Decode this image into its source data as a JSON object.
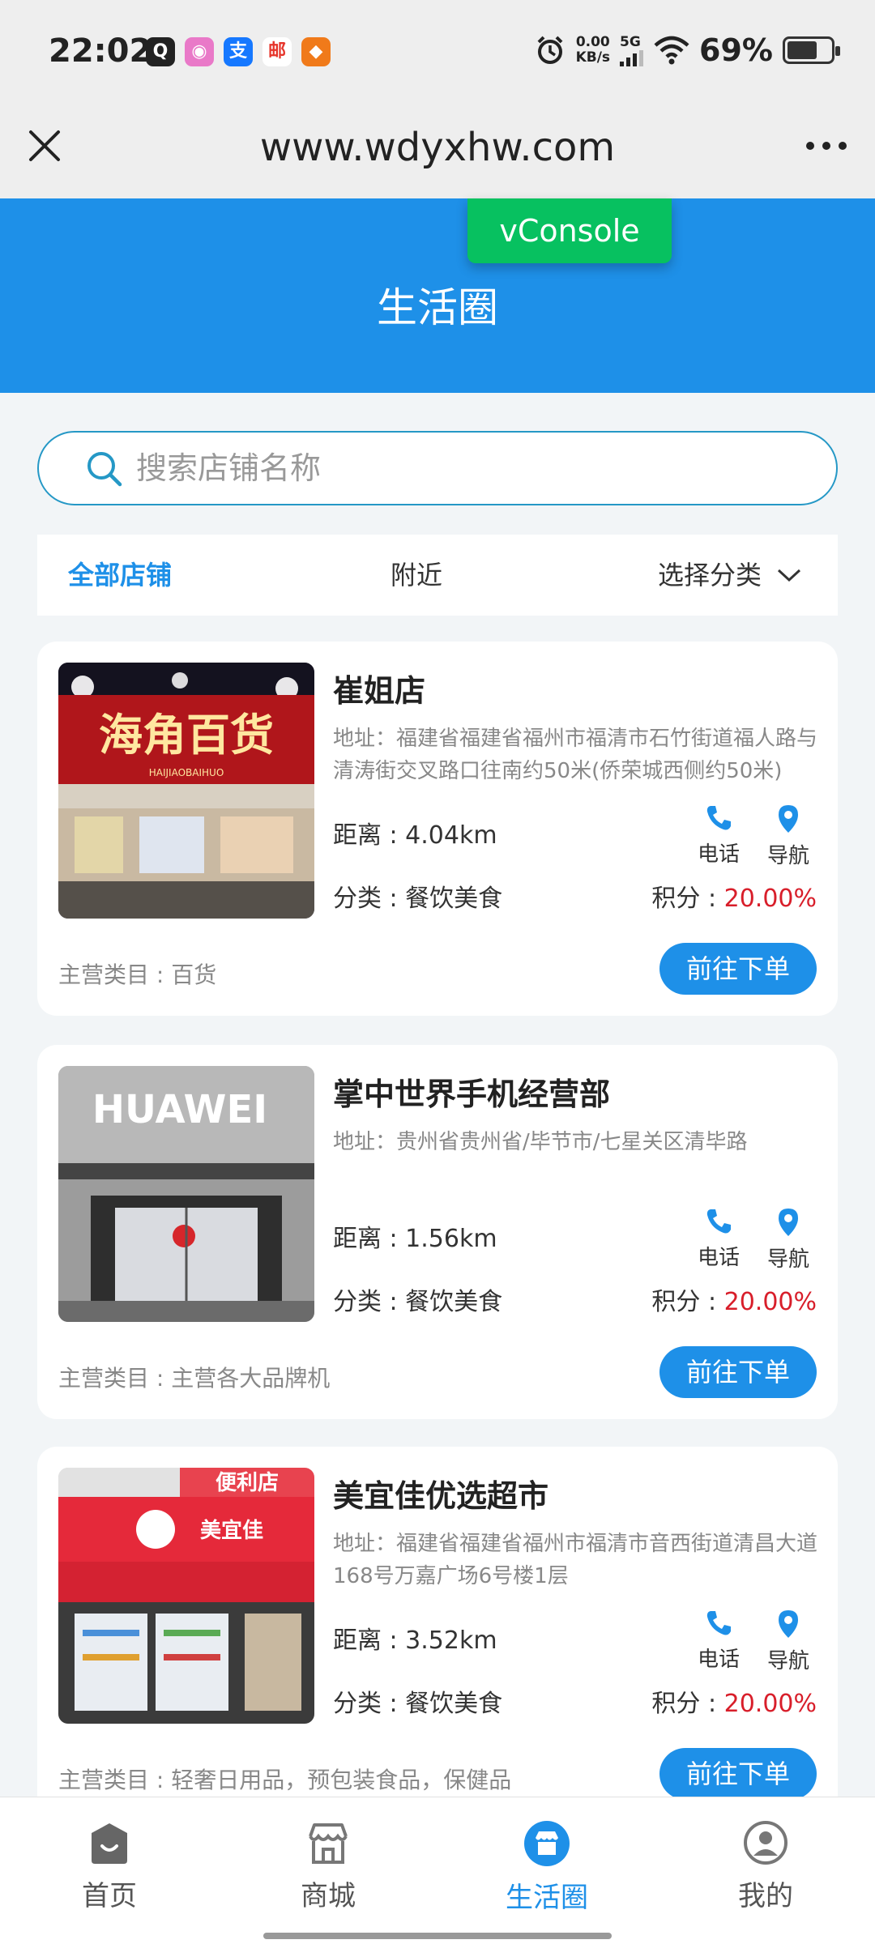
{
  "status_bar": {
    "time": "22:02",
    "apps": [
      {
        "icon": "qq-icon",
        "glyph": "Q",
        "color": "#222222"
      },
      {
        "icon": "camera-app-icon",
        "glyph": "◉",
        "color": "#e979c8"
      },
      {
        "icon": "alipay-icon",
        "glyph": "支",
        "color": "#1678ff"
      },
      {
        "icon": "postal-icon",
        "glyph": "邮",
        "color": "#e6352b"
      },
      {
        "icon": "shop-app-icon",
        "glyph": "◆",
        "color": "#f07a1a"
      }
    ],
    "net_speed_value": "0.00",
    "net_speed_unit": "KB/s",
    "network": "5G",
    "battery": "69%",
    "battery_level": 0.69
  },
  "browser": {
    "url": "www.wdyxhw.com"
  },
  "header": {
    "title": "生活圈",
    "vconsole_label": "vConsole"
  },
  "search": {
    "placeholder": "搜索店铺名称"
  },
  "filters": {
    "all": "全部店铺",
    "nearby": "附近",
    "category": "选择分类"
  },
  "stores": [
    {
      "name": "崔姐店",
      "address": "地址：福建省福建省福州市福清市石竹街道福人路与清涛街交叉路口往南约50米(侨荣城西侧约50米)",
      "distance": "距离 : 4.04km",
      "category": "分类 : 餐饮美食",
      "points_label": "积分 : ",
      "points_value": "20.00%",
      "main_category": "主营类目 : 百货",
      "phone_label": "电话",
      "nav_label": "导航",
      "order_label": "前往下单",
      "sign_text": "海角百货",
      "sign_sub": "HAIJIAOBAIHUO"
    },
    {
      "name": "掌中世界手机经营部",
      "address": "地址：贵州省贵州省/毕节市/七星关区清毕路",
      "distance": "距离 : 1.56km",
      "category": "分类 : 餐饮美食",
      "points_label": "积分 : ",
      "points_value": "20.00%",
      "main_category": "主营类目 : 主营各大品牌机",
      "phone_label": "电话",
      "nav_label": "导航",
      "order_label": "前往下单",
      "sign_text": "HUAWEI"
    },
    {
      "name": "美宜佳优选超市",
      "address": "地址：福建省福建省福州市福清市音西街道清昌大道168号万嘉广场6号楼1层",
      "distance": "距离 : 3.52km",
      "category": "分类 : 餐饮美食",
      "points_label": "积分 : ",
      "points_value": "20.00%",
      "main_category": "主营类目 : 轻奢日用品，预包装食品，保健品",
      "phone_label": "电话",
      "nav_label": "导航",
      "order_label": "前往下单",
      "sign_text": "便利店",
      "sign_sub": "美宜佳"
    }
  ],
  "bottom_nav": [
    {
      "label": "首页",
      "icon": "home-icon",
      "active": false
    },
    {
      "label": "商城",
      "icon": "store-icon",
      "active": false
    },
    {
      "label": "生活圈",
      "icon": "life-circle-icon",
      "active": true
    },
    {
      "label": "我的",
      "icon": "profile-icon",
      "active": false
    }
  ],
  "colors": {
    "primary": "#1e90e8",
    "points_red": "#d81e2a",
    "vconsole_green": "#07c160"
  }
}
